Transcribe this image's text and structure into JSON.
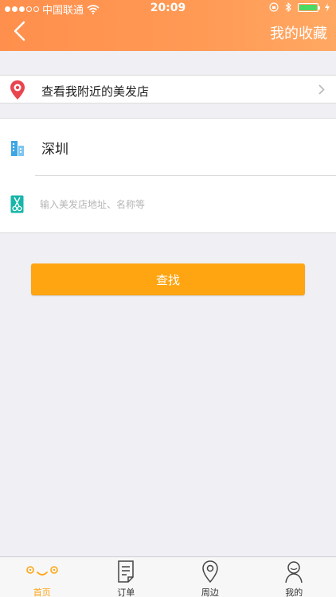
{
  "status_bar": {
    "carrier": "中国联通",
    "time": "20:09"
  },
  "header": {
    "right_title": "我的收藏"
  },
  "nearby": {
    "label": "查看我附近的美发店"
  },
  "search": {
    "city": "深圳",
    "address_placeholder": "输入美发店地址、名称等",
    "address_value": ""
  },
  "find_button": {
    "label": "查找"
  },
  "tabbar": {
    "items": [
      {
        "label": "首页",
        "icon": "face-icon",
        "active": true
      },
      {
        "label": "订单",
        "icon": "document-icon",
        "active": false
      },
      {
        "label": "周边",
        "icon": "location-pin-icon",
        "active": false
      },
      {
        "label": "我的",
        "icon": "person-icon",
        "active": false
      }
    ]
  },
  "colors": {
    "header_orange": "#ff9a55",
    "button_orange": "#ffa512",
    "pin_red": "#e9454f",
    "city_blue": "#3da6e3",
    "scissor_teal": "#18b5a8"
  }
}
